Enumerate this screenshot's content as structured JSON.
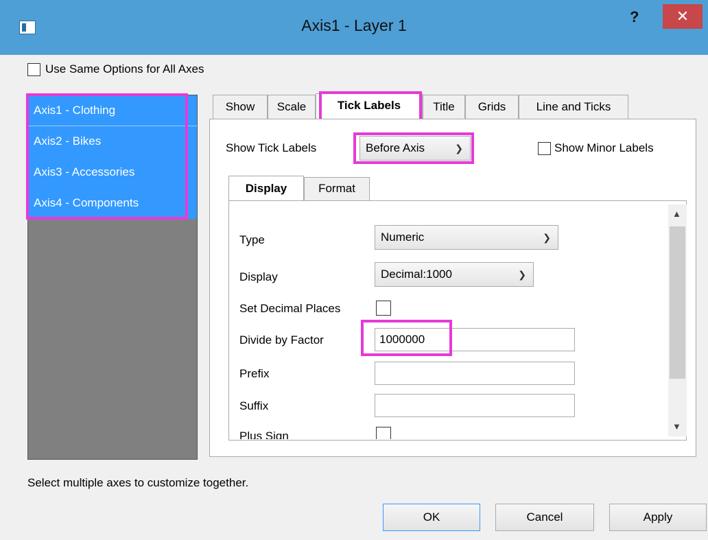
{
  "window": {
    "title": "Axis1 - Layer 1",
    "help": "?",
    "close": "✕"
  },
  "use_same_options": {
    "label": "Use Same Options for All Axes",
    "checked": false
  },
  "axes": [
    {
      "label": "Axis1 - Clothing"
    },
    {
      "label": "Axis2 - Bikes"
    },
    {
      "label": "Axis3 - Accessories"
    },
    {
      "label": "Axis4 - Components"
    }
  ],
  "tabs": [
    {
      "label": "Show"
    },
    {
      "label": "Scale"
    },
    {
      "label": "Tick Labels"
    },
    {
      "label": "Title"
    },
    {
      "label": "Grids"
    },
    {
      "label": "Line and Ticks"
    }
  ],
  "show_tick_labels": {
    "label": "Show Tick Labels",
    "value": "Before Axis"
  },
  "show_minor_labels": {
    "label": "Show Minor Labels",
    "checked": false
  },
  "inner_tabs": [
    {
      "label": "Display"
    },
    {
      "label": "Format"
    }
  ],
  "fields": {
    "type": {
      "label": "Type",
      "value": "Numeric"
    },
    "display": {
      "label": "Display",
      "value": "Decimal:1000"
    },
    "set_decimal_places": {
      "label": "Set Decimal Places"
    },
    "divide_by_factor": {
      "label": "Divide by Factor",
      "value": "1000000"
    },
    "prefix": {
      "label": "Prefix",
      "value": ""
    },
    "suffix": {
      "label": "Suffix",
      "value": ""
    },
    "plus_sign": {
      "label": "Plus Sign"
    }
  },
  "status_text": "Select multiple axes to customize together.",
  "buttons": {
    "ok": "OK",
    "cancel": "Cancel",
    "apply": "Apply"
  },
  "colors": {
    "title_bar": "#4e9fd6",
    "selection": "#3399ff",
    "highlight": "#e63ad8",
    "close": "#c7474a"
  }
}
